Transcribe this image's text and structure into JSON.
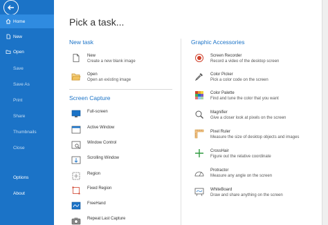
{
  "sidebar": {
    "items": [
      {
        "label": "Home",
        "icon": "home-icon"
      },
      {
        "label": "New",
        "icon": "new-file-icon"
      },
      {
        "label": "Open",
        "icon": "folder-icon"
      },
      {
        "label": "Save"
      },
      {
        "label": "Save As"
      },
      {
        "label": "Print"
      },
      {
        "label": "Share"
      },
      {
        "label": "Thumbnails"
      },
      {
        "label": "Close"
      },
      {
        "label": "Options"
      },
      {
        "label": "About"
      }
    ]
  },
  "main": {
    "title": "Pick a task...",
    "new_task": {
      "heading": "New task",
      "items": [
        {
          "name": "New",
          "desc": "Create a new blank image"
        },
        {
          "name": "Open",
          "desc": "Open an existing image"
        }
      ]
    },
    "screen_capture": {
      "heading": "Screen Capture",
      "items": [
        {
          "name": "Full-screen"
        },
        {
          "name": "Active Window"
        },
        {
          "name": "Window Control"
        },
        {
          "name": "Scrolling Window"
        },
        {
          "name": "Region"
        },
        {
          "name": "Fixed Region"
        },
        {
          "name": "FreeHand"
        },
        {
          "name": "Repeat Last Capture"
        }
      ]
    },
    "graphic_accessories": {
      "heading": "Graphic Accessories",
      "items": [
        {
          "name": "Screen Recorder",
          "desc": "Record a video of the desktop screen"
        },
        {
          "name": "Color Picker",
          "desc": "Pick a color code on the screen"
        },
        {
          "name": "Color Palette",
          "desc": "Find and tune the color that you want"
        },
        {
          "name": "Magnifier",
          "desc": "Give a closer look at pixels on the screen"
        },
        {
          "name": "Pixel Ruler",
          "desc": "Measure the size of desktop objects and images"
        },
        {
          "name": "CrossHair",
          "desc": "Figure out the relative coordinate"
        },
        {
          "name": "Protractor",
          "desc": "Measure any angle on the screen"
        },
        {
          "name": "WhiteBoard",
          "desc": "Draw and share anything on the screen"
        }
      ]
    }
  },
  "colors": {
    "sidebar": "#1b73c7",
    "sidebar_active": "#2f8be0",
    "accent": "#1b73c7"
  }
}
